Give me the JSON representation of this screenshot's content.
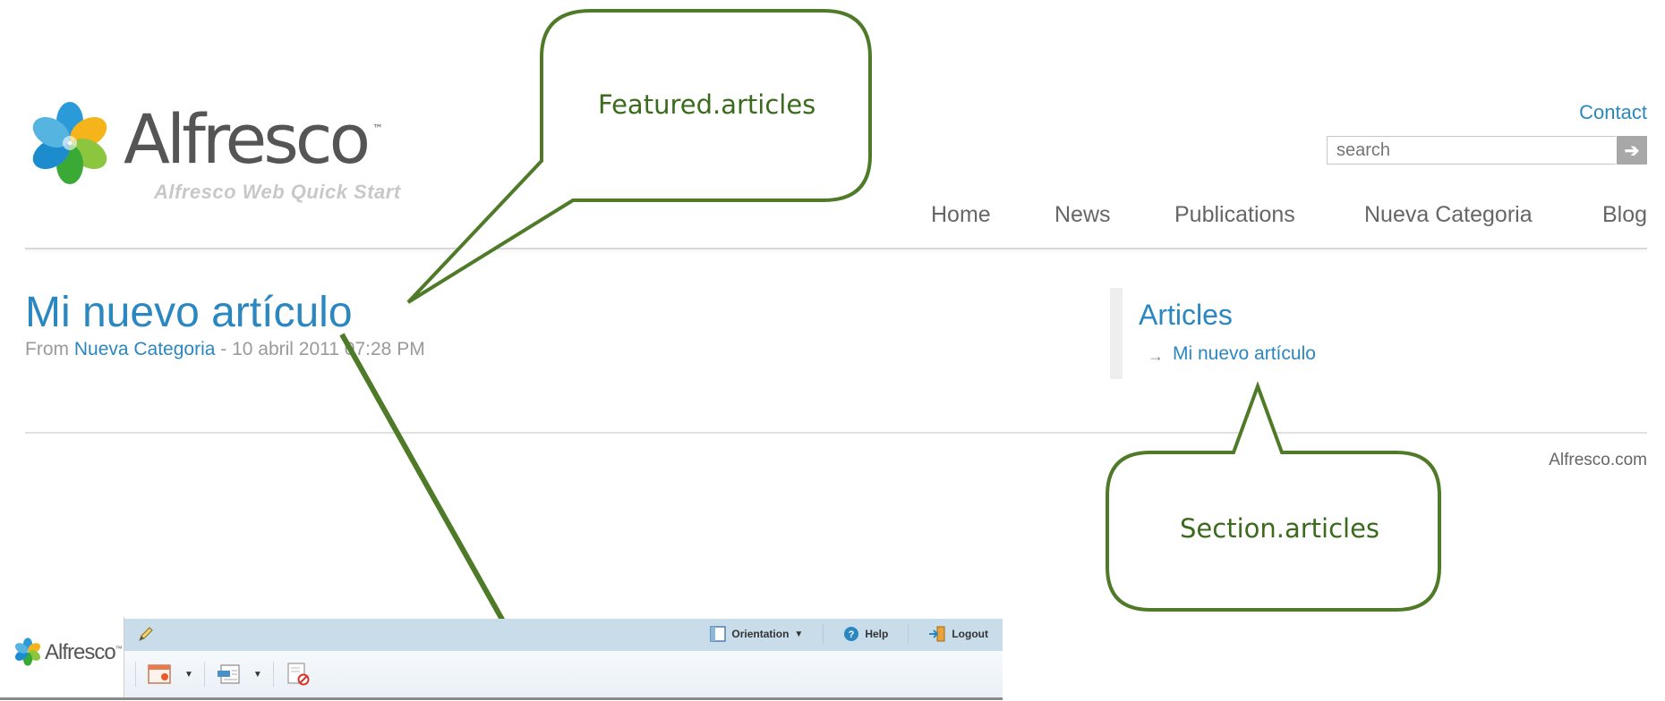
{
  "header": {
    "brand_name": "Alfresco",
    "brand_mark": "™",
    "tagline": "Alfresco Web Quick Start",
    "contact_label": "Contact",
    "search_placeholder": "search",
    "search_button_glyph": "➔",
    "nav": [
      {
        "label": "Home"
      },
      {
        "label": "News"
      },
      {
        "label": "Publications"
      },
      {
        "label": "Nueva Categoria"
      },
      {
        "label": "Blog"
      }
    ]
  },
  "article": {
    "title": "Mi nuevo artículo",
    "from_label": "From",
    "category": "Nueva Categoria",
    "date": " - 10 abril 2011 07:28 PM"
  },
  "sidebar": {
    "title": "Articles",
    "arrow": "→",
    "items": [
      {
        "label": "Mi nuevo artículo"
      }
    ]
  },
  "footer": {
    "link": "Alfresco.com"
  },
  "callouts": {
    "featured": "Featured.articles",
    "section": "Section.articles"
  },
  "editor_toolbar": {
    "brand_name": "Alfresco",
    "brand_mark": "™",
    "orientation_label": "Orientation",
    "help_label": "Help",
    "logout_label": "Logout"
  },
  "colors": {
    "link_blue": "#2b87c0",
    "callout_green": "#4f7a28",
    "callout_text": "#3b6b1d",
    "toolbar_blue": "#c8dcea"
  }
}
